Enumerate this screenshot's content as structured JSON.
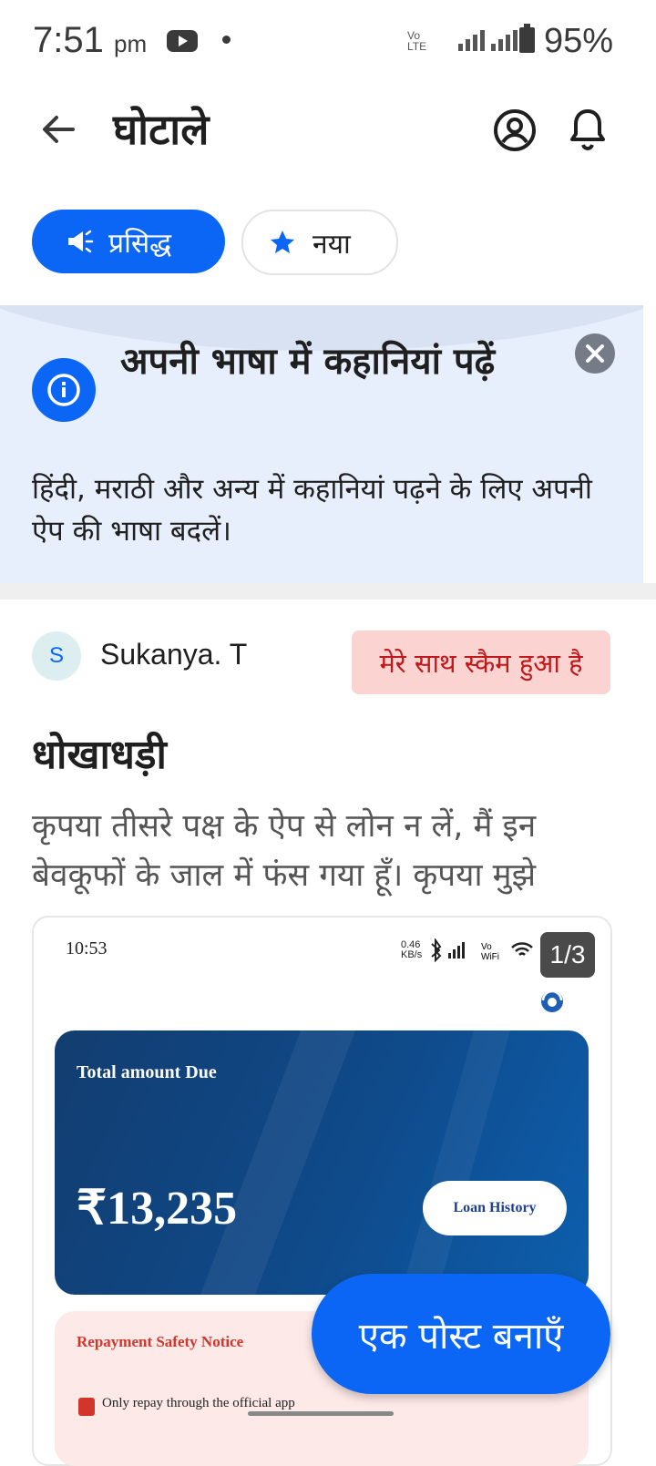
{
  "status_bar": {
    "time": "7:51",
    "ampm": "pm",
    "network_top": "Vo",
    "network_bottom": "LTE",
    "lte": "LTE",
    "battery": "95%"
  },
  "header": {
    "title": "घोटाले"
  },
  "filters": {
    "popular_label": "प्रसिद्ध",
    "new_label": "नया"
  },
  "banner": {
    "title": "अपनी भाषा में कहानियां पढ़ें",
    "text": "हिंदी, मराठी और अन्य में कहानियां पढ़ने के लिए अपनी ऐप की भाषा बदलें।"
  },
  "post": {
    "avatar_initial": "S",
    "author": "Sukanya. T",
    "tag": "मेरे साथ स्कैम हुआ है",
    "title": "धोखाधड़ी",
    "body": "कृपया तीसरे पक्ष के ऐप से लोन न लें, मैं इन बेवकूफों के जाल में फंस गया हूँ। कृपया मुझे",
    "image": {
      "time": "10:53",
      "speed_top": "0.46",
      "speed_bottom": "KB/s",
      "counter": "1/3",
      "due_label": "Total amount Due",
      "due_amount": "₹13,235",
      "loan_history": "Loan History",
      "notice_title": "Repayment Safety Notice",
      "notice_line": "Only repay through the official app"
    }
  },
  "fab": {
    "label": "एक पोस्ट बनाएँ"
  },
  "colors": {
    "accent": "#0b66f6",
    "tag_bg": "#fbd4d2",
    "tag_text": "#c0191b",
    "banner_bg": "#e7effc"
  }
}
